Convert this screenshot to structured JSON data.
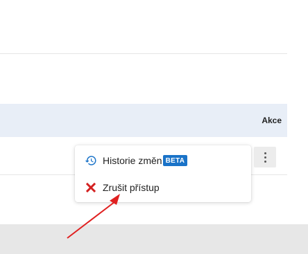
{
  "table": {
    "header": {
      "actions_label": "Akce"
    }
  },
  "row_actions": {
    "kebab_icon": "more-vertical-icon"
  },
  "context_menu": {
    "items": [
      {
        "label": "Historie změn",
        "badge": "BETA",
        "icon": "history-icon",
        "icon_color": "#1a73c8",
        "badge_color": "#1a73c8"
      },
      {
        "label": "Zrušit přístup",
        "icon": "close-icon",
        "icon_color": "#d32020"
      }
    ]
  },
  "annotation": {
    "arrow_color": "#e02020"
  }
}
